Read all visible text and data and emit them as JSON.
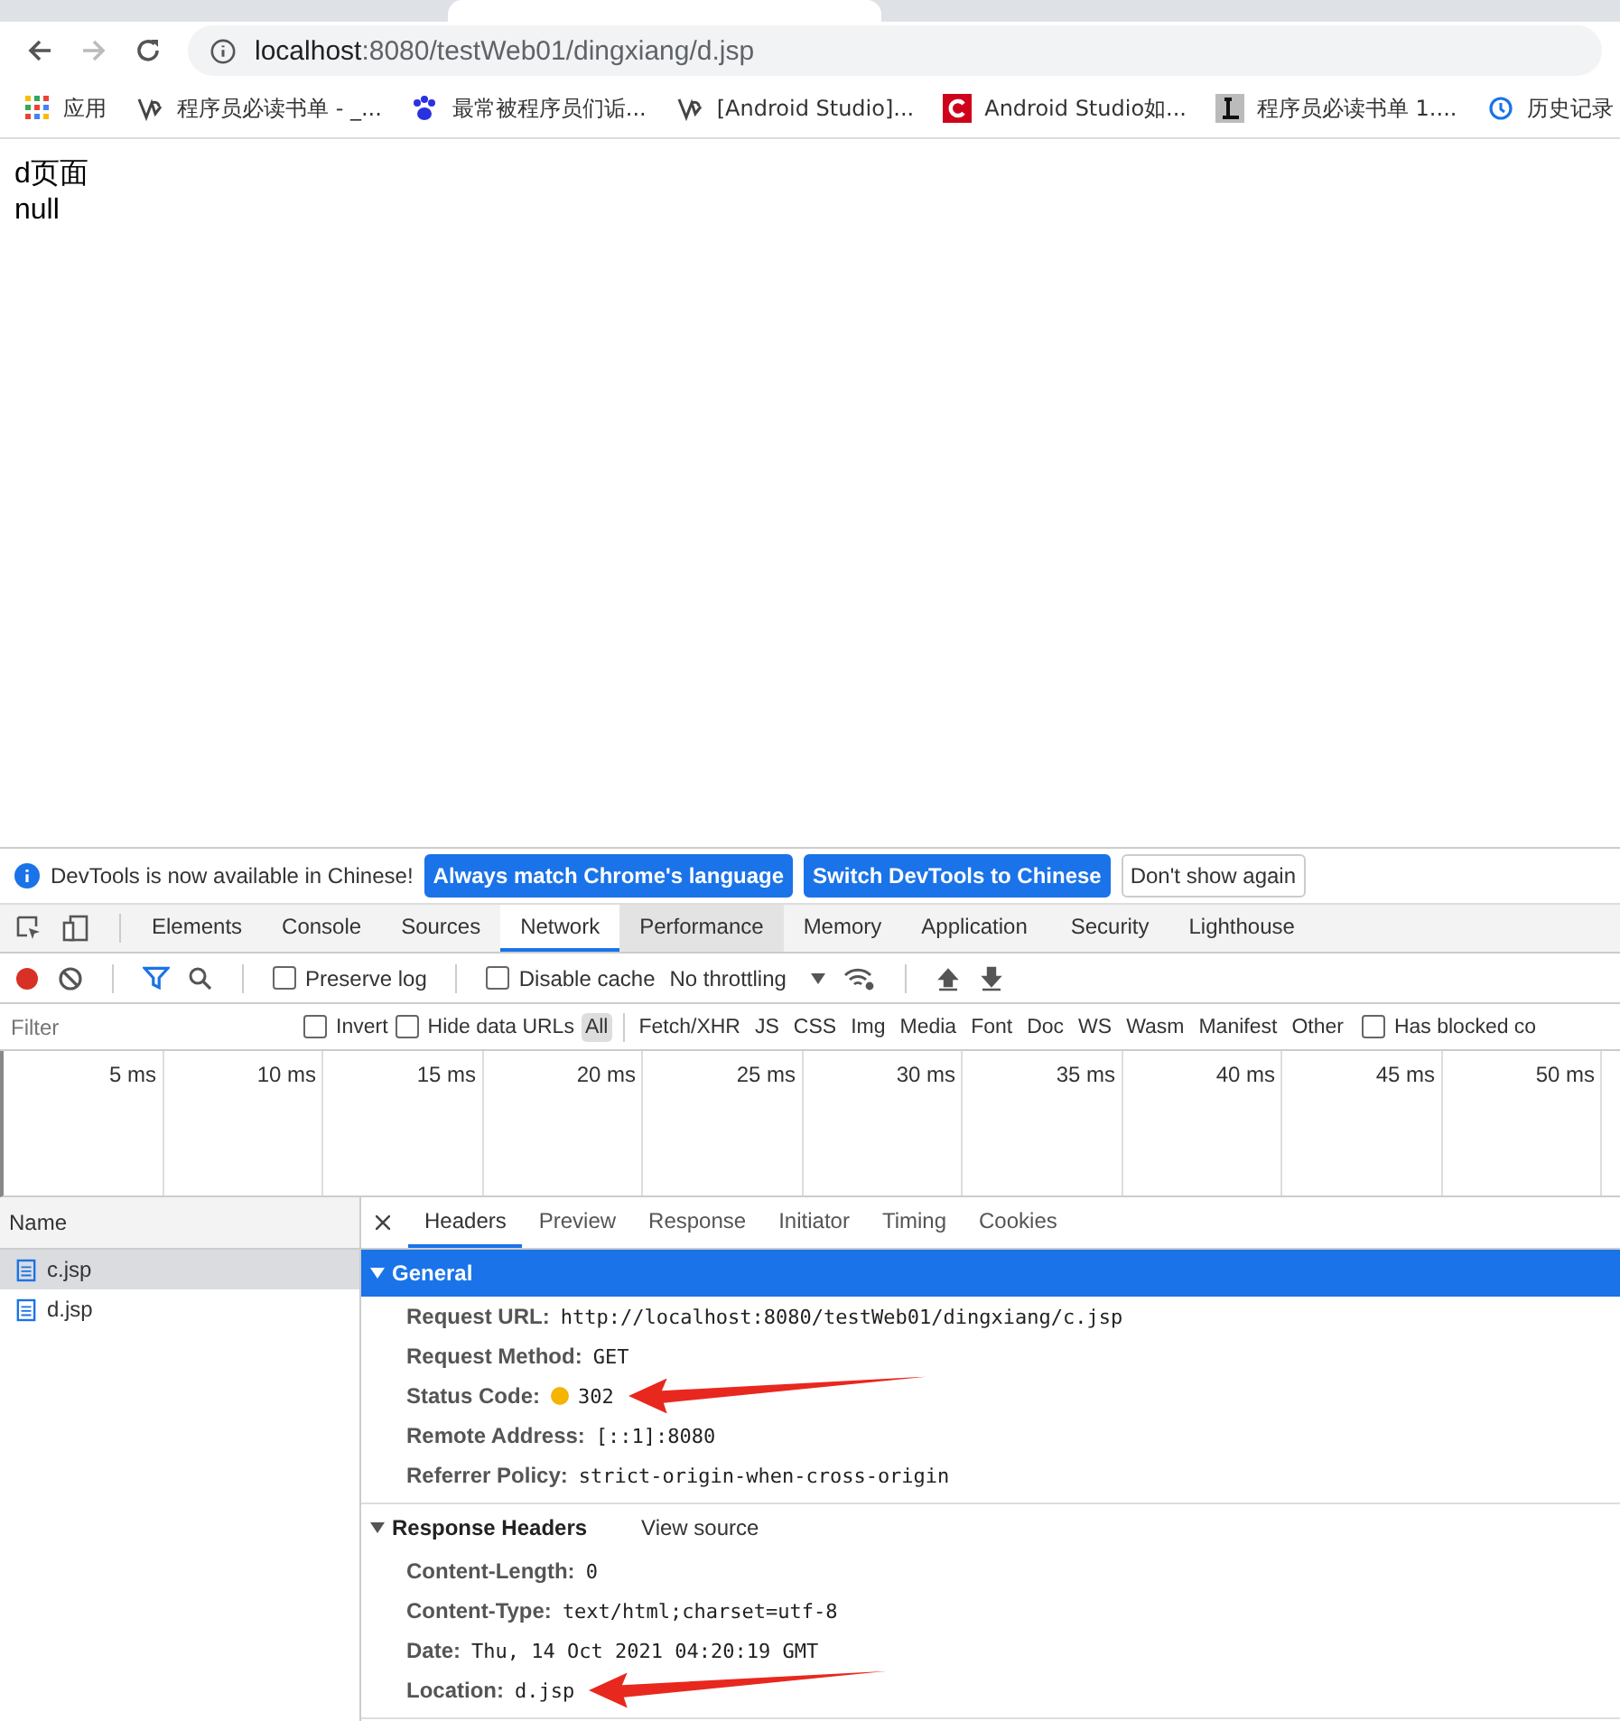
{
  "browser": {
    "url_host": "localhost",
    "url_rest": ":8080/testWeb01/dingxiang/d.jsp",
    "bookmarks": [
      {
        "kind": "apps",
        "label": "应用"
      },
      {
        "kind": "glyph",
        "label": "程序员必读书单 - _..."
      },
      {
        "kind": "paw",
        "label": "最常被程序员们诟..."
      },
      {
        "kind": "glyph",
        "label": "[Android Studio]..."
      },
      {
        "kind": "c",
        "label": "Android Studio如..."
      },
      {
        "kind": "l",
        "label": "程序员必读书单 1...."
      },
      {
        "kind": "history",
        "label": "历史记录"
      }
    ]
  },
  "page": {
    "lines": [
      "d页面",
      "null"
    ]
  },
  "devtools": {
    "infobar": {
      "message": "DevTools is now available in Chinese!",
      "buttons": [
        {
          "label": "Always match Chrome's language",
          "kind": "primary"
        },
        {
          "label": "Switch DevTools to Chinese",
          "kind": "primary"
        },
        {
          "label": "Don't show again",
          "kind": "plain"
        }
      ]
    },
    "tabs": [
      {
        "label": "Elements",
        "selected": false,
        "hover": false
      },
      {
        "label": "Console",
        "selected": false,
        "hover": false
      },
      {
        "label": "Sources",
        "selected": false,
        "hover": false
      },
      {
        "label": "Network",
        "selected": true,
        "hover": false
      },
      {
        "label": "Performance",
        "selected": false,
        "hover": true
      },
      {
        "label": "Memory",
        "selected": false,
        "hover": false
      },
      {
        "label": "Application",
        "selected": false,
        "hover": false
      },
      {
        "label": "Security",
        "selected": false,
        "hover": false
      },
      {
        "label": "Lighthouse",
        "selected": false,
        "hover": false
      }
    ],
    "toolbar": {
      "recording": true,
      "preserve_log": {
        "label": "Preserve log",
        "checked": false
      },
      "disable_cache": {
        "label": "Disable cache",
        "checked": false
      },
      "throttling": "No throttling"
    },
    "filter": {
      "placeholder": "Filter",
      "invert": {
        "label": "Invert",
        "checked": false
      },
      "hide_data_urls": {
        "label": "Hide data URLs",
        "checked": false
      },
      "types": [
        {
          "label": "All",
          "selected": true
        },
        {
          "label": "Fetch/XHR",
          "selected": false
        },
        {
          "label": "JS",
          "selected": false
        },
        {
          "label": "CSS",
          "selected": false
        },
        {
          "label": "Img",
          "selected": false
        },
        {
          "label": "Media",
          "selected": false
        },
        {
          "label": "Font",
          "selected": false
        },
        {
          "label": "Doc",
          "selected": false
        },
        {
          "label": "WS",
          "selected": false
        },
        {
          "label": "Wasm",
          "selected": false
        },
        {
          "label": "Manifest",
          "selected": false
        },
        {
          "label": "Other",
          "selected": false
        }
      ],
      "has_blocked": {
        "label": "Has blocked co",
        "checked": false
      }
    },
    "timeline_ticks": [
      "5 ms",
      "10 ms",
      "15 ms",
      "20 ms",
      "25 ms",
      "30 ms",
      "35 ms",
      "40 ms",
      "45 ms",
      "50 ms"
    ],
    "requests": {
      "column": "Name",
      "rows": [
        {
          "name": "c.jsp",
          "selected": true
        },
        {
          "name": "d.jsp",
          "selected": false
        }
      ]
    },
    "detail_tabs": [
      {
        "label": "Headers",
        "selected": true
      },
      {
        "label": "Preview",
        "selected": false
      },
      {
        "label": "Response",
        "selected": false
      },
      {
        "label": "Initiator",
        "selected": false
      },
      {
        "label": "Timing",
        "selected": false
      },
      {
        "label": "Cookies",
        "selected": false
      }
    ],
    "sections": [
      {
        "title": "General",
        "expanded": true,
        "highlighted": true,
        "rows": [
          {
            "key": "Request URL:",
            "value": "http://localhost:8080/testWeb01/dingxiang/c.jsp",
            "arrow": false
          },
          {
            "key": "Request Method:",
            "value": "GET",
            "arrow": false
          },
          {
            "key": "Status Code:",
            "value": "302",
            "color": "#f4b400",
            "arrow": true
          },
          {
            "key": "Remote Address:",
            "value": "[::1]:8080",
            "arrow": false
          },
          {
            "key": "Referrer Policy:",
            "value": "strict-origin-when-cross-origin",
            "arrow": false
          }
        ]
      },
      {
        "title": "Response Headers",
        "link": "View source",
        "expanded": true,
        "highlighted": false,
        "rows": [
          {
            "key": "Content-Length:",
            "value": "0",
            "arrow": false
          },
          {
            "key": "Content-Type:",
            "value": "text/html;charset=utf-8",
            "arrow": false
          },
          {
            "key": "Date:",
            "value": "Thu, 14 Oct 2021 04:20:19 GMT",
            "arrow": false
          },
          {
            "key": "Location:",
            "value": "d.jsp",
            "arrow": true
          }
        ]
      }
    ]
  }
}
